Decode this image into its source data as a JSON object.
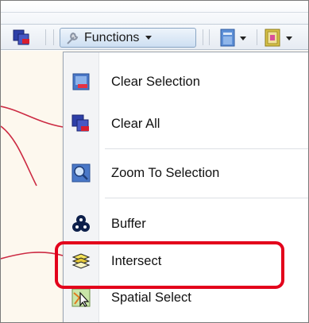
{
  "toolbar": {
    "functions_label": "Functions",
    "icons": [
      "selection-tool-icon",
      "wrench-icon",
      "document-icon",
      "layers-panel-icon"
    ]
  },
  "menu": {
    "items": [
      {
        "label": "Clear Selection",
        "icon": "clear-selection-icon"
      },
      {
        "label": "Clear All",
        "icon": "clear-all-icon"
      },
      {
        "label": "Zoom To Selection",
        "icon": "zoom-to-selection-icon"
      },
      {
        "label": "Buffer",
        "icon": "buffer-icon"
      },
      {
        "label": "Intersect",
        "icon": "intersect-icon"
      },
      {
        "label": "Spatial Select",
        "icon": "spatial-select-icon"
      }
    ]
  },
  "colors": {
    "highlight": "#e3001b",
    "map_line": "#cc2b43",
    "map_background": "#fdf8ee"
  }
}
